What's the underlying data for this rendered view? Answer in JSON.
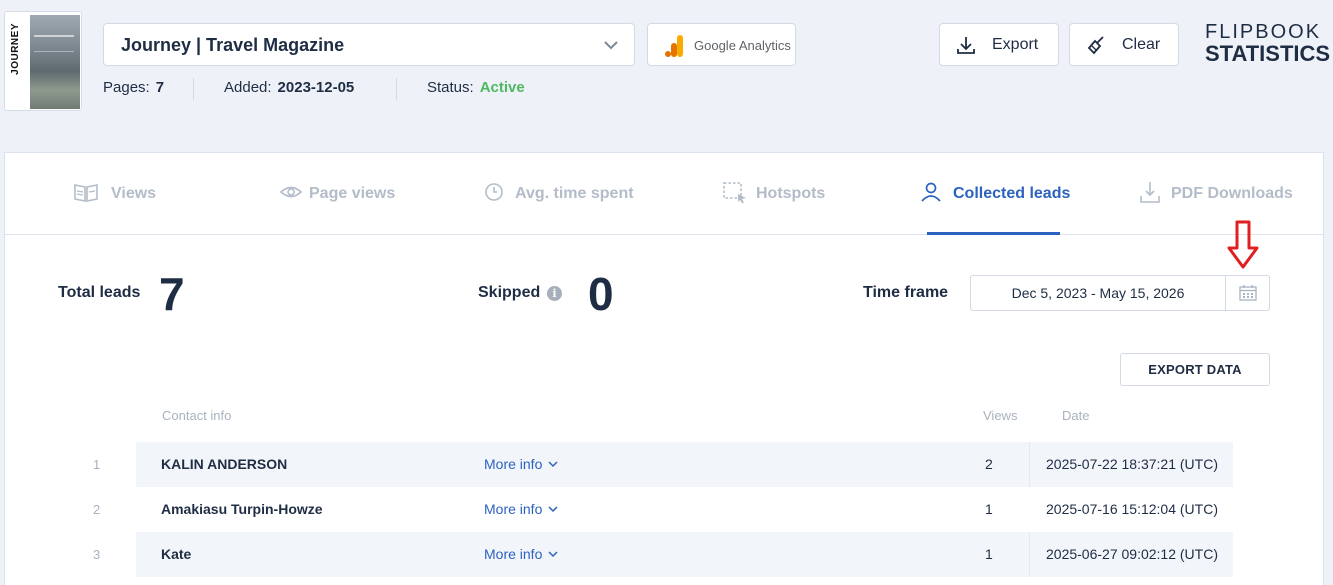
{
  "cover": {
    "title": "JOURNEY"
  },
  "magazine": {
    "title": "Journey | Travel Magazine"
  },
  "google_analytics": {
    "label": "Google Analytics"
  },
  "meta": {
    "pages_label": "Pages:",
    "pages_value": "7",
    "added_label": "Added:",
    "added_value": "2023-12-05",
    "status_label": "Status:",
    "status_value": "Active"
  },
  "toolbar": {
    "export_label": "Export",
    "clear_label": "Clear"
  },
  "brand": {
    "line1": "FLIPBOOK",
    "line2": "STATISTICS"
  },
  "tabs": [
    {
      "label": "Views",
      "icon": "views-icon",
      "active": false
    },
    {
      "label": "Page views",
      "icon": "eye-icon",
      "active": false
    },
    {
      "label": "Avg. time spent",
      "icon": "clock-icon",
      "active": false
    },
    {
      "label": "Hotspots",
      "icon": "hotspot-icon",
      "active": false
    },
    {
      "label": "Collected leads",
      "icon": "user-icon",
      "active": true
    },
    {
      "label": "PDF Downloads",
      "icon": "download-icon",
      "active": false
    }
  ],
  "stats": {
    "total_leads_label": "Total leads",
    "total_leads_value": "7",
    "skipped_label": "Skipped",
    "skipped_value": "0",
    "time_frame_label": "Time frame",
    "time_frame_value": "Dec 5, 2023 - May 15, 2026"
  },
  "export_data_label": "EXPORT DATA",
  "table": {
    "headers": {
      "contact": "Contact info",
      "views": "Views",
      "date": "Date"
    },
    "more_info_label": "More info",
    "rows": [
      {
        "num": "1",
        "name": "KALIN ANDERSON",
        "views": "2",
        "date": "2025-07-22 18:37:21 (UTC)"
      },
      {
        "num": "2",
        "name": "Amakiasu Turpin-Howze",
        "views": "1",
        "date": "2025-07-16 15:12:04 (UTC)"
      },
      {
        "num": "3",
        "name": "Kate",
        "views": "1",
        "date": "2025-06-27 09:02:12 (UTC)"
      }
    ]
  },
  "colors": {
    "accent": "#2c62bf",
    "active_status": "#4fb960",
    "annotation_arrow": "#e02020",
    "text": "#1f2d44"
  }
}
